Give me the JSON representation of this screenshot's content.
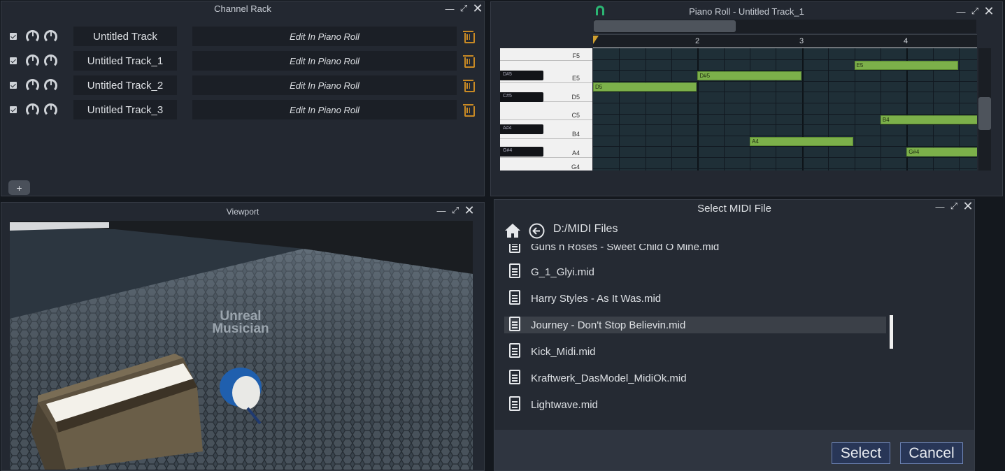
{
  "channel_rack": {
    "title": "Channel Rack",
    "tracks": [
      {
        "name": "Untitled Track",
        "edit_label": "Edit In Piano Roll"
      },
      {
        "name": "Untitled Track_1",
        "edit_label": "Edit In Piano Roll"
      },
      {
        "name": "Untitled Track_2",
        "edit_label": "Edit In Piano Roll"
      },
      {
        "name": "Untitled Track_3",
        "edit_label": "Edit In Piano Roll"
      }
    ],
    "add_label": "+"
  },
  "piano_roll": {
    "title": "Piano Roll - Untitled Track_1",
    "ruler": [
      "2",
      "3",
      "4"
    ],
    "white_keys": [
      "F5",
      "E5",
      "D5",
      "C5",
      "B4",
      "A4",
      "G4"
    ],
    "black_keys": [
      "D#5",
      "C#5",
      "A#4",
      "G#4"
    ],
    "notes": [
      {
        "label": "E5",
        "pitch": "E5",
        "start": 3.5,
        "length": 1.0
      },
      {
        "label": "D#5",
        "pitch": "D#5",
        "start": 2.0,
        "length": 1.0
      },
      {
        "label": "D5",
        "pitch": "D5",
        "start": 1.0,
        "length": 1.0
      },
      {
        "label": "B4",
        "pitch": "B4",
        "start": 3.75,
        "length": 1.0
      },
      {
        "label": "A4",
        "pitch": "A4",
        "start": 2.5,
        "length": 1.0
      },
      {
        "label": "G#4",
        "pitch": "G#4",
        "start": 4.0,
        "length": 0.75
      }
    ]
  },
  "viewport": {
    "title": "Viewport",
    "scene_text_line1": "Unreal",
    "scene_text_line2": "Musician"
  },
  "file_dialog": {
    "title": "Select MIDI File",
    "path": "D:/MIDI Files",
    "partial_file": "Guns n Roses - Sweet Child O Mine.mid",
    "files": [
      "G_1_Glyi.mid",
      "Harry Styles - As It Was.mid",
      "Journey - Don't Stop Believin.mid",
      "Kick_Midi.mid",
      "Kraftwerk_DasModel_MidiOk.mid",
      "Lightwave.mid"
    ],
    "selected_index": 2,
    "select_label": "Select",
    "cancel_label": "Cancel"
  },
  "colors": {
    "accent_note": "#7cb04a",
    "trash": "#c98a24",
    "magnet": "#2bb673"
  }
}
